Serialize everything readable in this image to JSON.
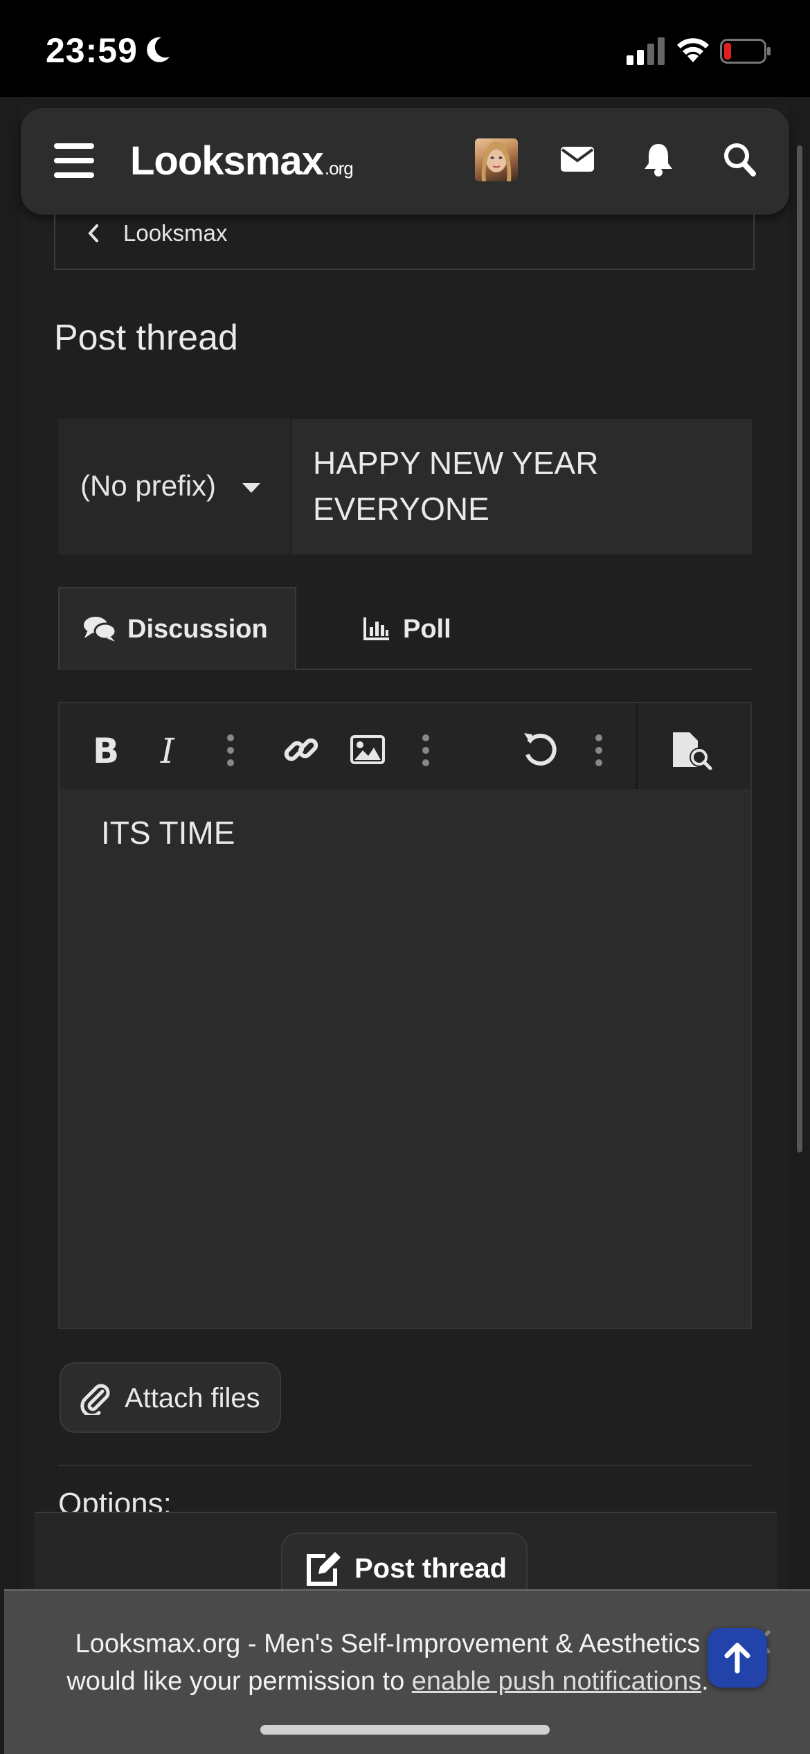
{
  "status_bar": {
    "time": "23:59"
  },
  "header": {
    "logo_text": "Looksmax",
    "logo_suffix": ".org"
  },
  "breadcrumb": {
    "label": "Looksmax"
  },
  "page_title": "Post thread",
  "form": {
    "prefix_value": "(No prefix)",
    "title_value": "HAPPY NEW YEAR EVERYONE"
  },
  "tabs": [
    {
      "label": "Discussion",
      "active": true
    },
    {
      "label": "Poll",
      "active": false
    }
  ],
  "editor": {
    "toolbar": [
      "bold-icon",
      "italic-icon",
      "more-text-icon",
      "link-icon",
      "image-icon",
      "more-insert-icon",
      "undo-icon",
      "more-options-icon",
      "preview-icon"
    ],
    "body_text": "ITS TIME"
  },
  "attach_label": "Attach files",
  "options_heading": "Options:",
  "post_button_label": "Post thread",
  "notification": {
    "text_before": "Looksmax.org - Men's Self-Improvement & Aesthetics would like your permission to ",
    "link_text": "enable push notifications",
    "text_after": "."
  },
  "colors": {
    "background": "#1c1c1c",
    "header": "#2d2d2d",
    "scroll_top_button": "#2244aa",
    "battery_low": "#e02020"
  }
}
